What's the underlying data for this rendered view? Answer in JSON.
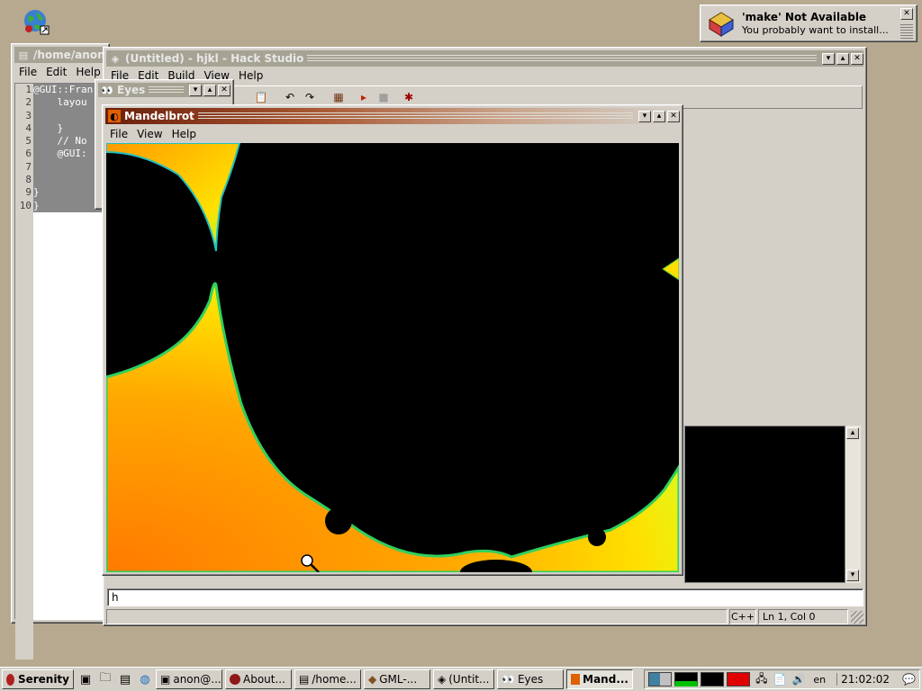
{
  "desktop": {
    "icons": [
      "globe-icon"
    ]
  },
  "notification": {
    "title": "'make' Not Available",
    "message": "You probably want to install..."
  },
  "editor_window": {
    "title": "/home/anon/s",
    "menu": [
      "File",
      "Edit",
      "Help"
    ],
    "line_numbers": [
      "1",
      "2",
      "3",
      "4",
      "5",
      "6",
      "7",
      "8",
      "9",
      "10"
    ],
    "lines": [
      "@GUI::Fran",
      "    layou",
      "",
      "    }",
      "    // No",
      "    @GUI:",
      "",
      "",
      "}",
      "}"
    ]
  },
  "hack_studio": {
    "title": "(Untitled) - hjkl - Hack Studio",
    "menu": [
      "File",
      "Edit",
      "Build",
      "View",
      "Help"
    ],
    "input_value": "h",
    "status": {
      "language": "C++",
      "position": "Ln 1, Col 0"
    }
  },
  "eyes_window": {
    "title": "Eyes"
  },
  "mandelbrot_window": {
    "title": "Mandelbrot",
    "menu": [
      "File",
      "View",
      "Help"
    ]
  },
  "taskbar": {
    "start_label": "Serenity",
    "tasks": [
      {
        "label": "anon@...",
        "icon": "terminal-icon"
      },
      {
        "label": "About...",
        "icon": "serenity-icon"
      },
      {
        "label": "/home...",
        "icon": "editor-icon"
      },
      {
        "label": "GML-...",
        "icon": "gml-icon"
      },
      {
        "label": "(Untit...",
        "icon": "hackstudio-icon"
      },
      {
        "label": "Eyes",
        "icon": "eyes-icon"
      },
      {
        "label": "Mand...",
        "icon": "mandelbrot-icon"
      }
    ],
    "keyboard_layout": "en",
    "clock": "21:02:02"
  },
  "colors": {
    "desktop": "#b6a98f",
    "active_title": "#a75531",
    "cpu_graph": "#00c000",
    "mem_graph": "#e00000"
  }
}
